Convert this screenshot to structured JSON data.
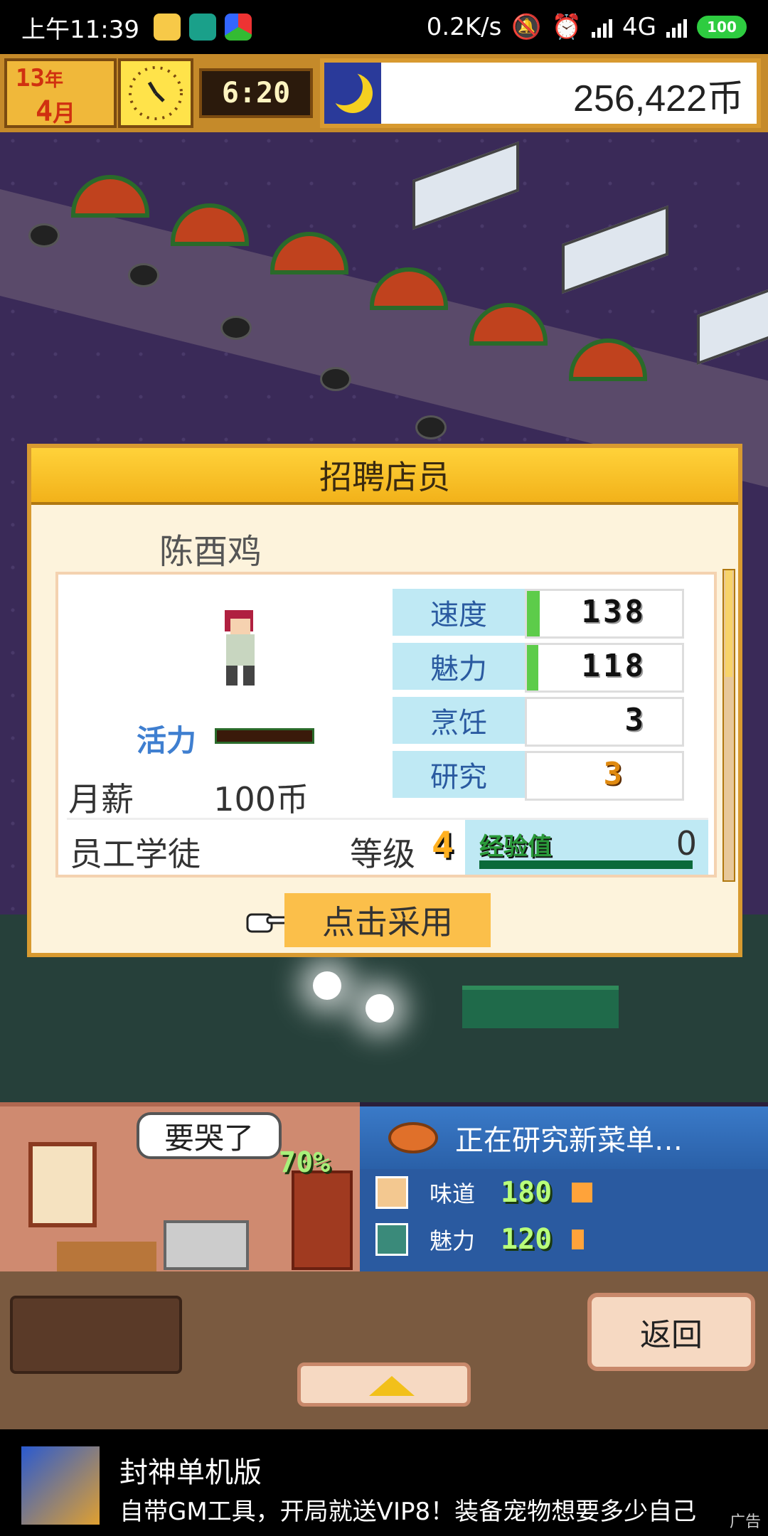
{
  "status_bar": {
    "time": "上午11:39",
    "net_speed": "0.2K/s",
    "network": "4G",
    "battery": "100"
  },
  "hud": {
    "year_num": "13",
    "year_unit": "年",
    "month_num": "4",
    "month_unit": "月",
    "time": "6:20",
    "money": "256,422币"
  },
  "dialog": {
    "title": "招聘店员",
    "candidate_name": "陈酉鸡",
    "vitality_label": "活力",
    "salary_label": "月薪",
    "salary_value": "100币",
    "stats": [
      {
        "name": "速度",
        "value": "138",
        "bar": 0.08
      },
      {
        "name": "魅力",
        "value": "118",
        "bar": 0.07
      },
      {
        "name": "烹饪",
        "value": "3",
        "bar": 0
      },
      {
        "name": "研究",
        "value": "3",
        "bar": 0
      }
    ],
    "role": "员工学徒",
    "level_label": "等级",
    "level": "4",
    "exp_label": "经验值",
    "exp_value": "0",
    "hire_button": "点击采用"
  },
  "kitchen": {
    "speech": "要哭了",
    "progress": "70%"
  },
  "research": {
    "title": "正在研究新菜单…",
    "rows": [
      {
        "label": "味道",
        "value": "180",
        "bar": 0.05
      },
      {
        "label": "魅力",
        "value": "120",
        "bar": 0.03
      }
    ]
  },
  "tray": {
    "back_button": "返回"
  },
  "ad": {
    "title": "封神单机版",
    "description": "自带GM工具，开局就送VIP8！装备宠物想要多少自己",
    "tag": "广告"
  },
  "colors": {
    "dialog_border": "#d89a30",
    "stat_name_bg": "#bfe9f4",
    "stat_bar": "#5dcc4a",
    "hire_button_bg": "#fbbf4a"
  }
}
